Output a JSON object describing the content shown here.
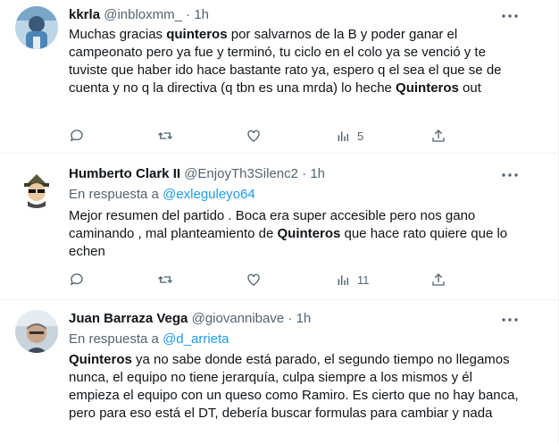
{
  "tweets": [
    {
      "name": "kkrla",
      "handle": "@inbloxmm_",
      "dot": "·",
      "time": "1h",
      "reply_prefix": "",
      "reply_handle": "",
      "body_parts": [
        {
          "t": "Muchas gracias ",
          "b": false
        },
        {
          "t": "quinteros",
          "b": true
        },
        {
          "t": " por salvarnos de la B y poder ganar el campeonato pero ya fue y terminó, tu ciclo en el colo ya se venció y te tuviste que haber ido hace bastante rato ya, espero q el sea el que se de cuenta y no q la directiva (q tbn es una mrda) lo heche ",
          "b": false
        },
        {
          "t": "Quinteros",
          "b": true
        },
        {
          "t": " out",
          "b": false
        }
      ],
      "views": "5"
    },
    {
      "name": "Humberto Clark II",
      "handle": "@EnjoyTh3Silenc2",
      "dot": "·",
      "time": "1h",
      "reply_prefix": "En respuesta a ",
      "reply_handle": "@exleguleyo64",
      "body_parts": [
        {
          "t": "Mejor resumen del partido . Boca era super accesible pero nos gano caminando , mal planteamiento de ",
          "b": false
        },
        {
          "t": "Quinteros",
          "b": true
        },
        {
          "t": " que hace rato quiere que lo echen",
          "b": false
        }
      ],
      "views": "11"
    },
    {
      "name": "Juan Barraza Vega",
      "handle": "@giovannibave",
      "dot": "·",
      "time": "1h",
      "reply_prefix": "En respuesta a ",
      "reply_handle": "@d_arrieta",
      "body_parts": [
        {
          "t": "Quinteros",
          "b": true
        },
        {
          "t": " ya no sabe donde está parado, el segundo tiempo no llegamos nunca, el equipo no tiene jerarquía, culpa siempre a los mismos y él empieza el equipo con un queso como Ramiro. Es cierto que no hay banca, pero para eso está el DT, debería buscar formulas para cambiar y nada",
          "b": false
        }
      ],
      "views": ""
    }
  ],
  "colors": {
    "text": "#0f1419",
    "secondary": "#536471",
    "link": "#1d9bf0",
    "border": "#eff3f4"
  },
  "icons": {
    "more": "more-horizontal-icon",
    "reply": "reply-icon",
    "retweet": "retweet-icon",
    "like": "like-icon",
    "views": "views-icon",
    "share": "share-icon"
  }
}
